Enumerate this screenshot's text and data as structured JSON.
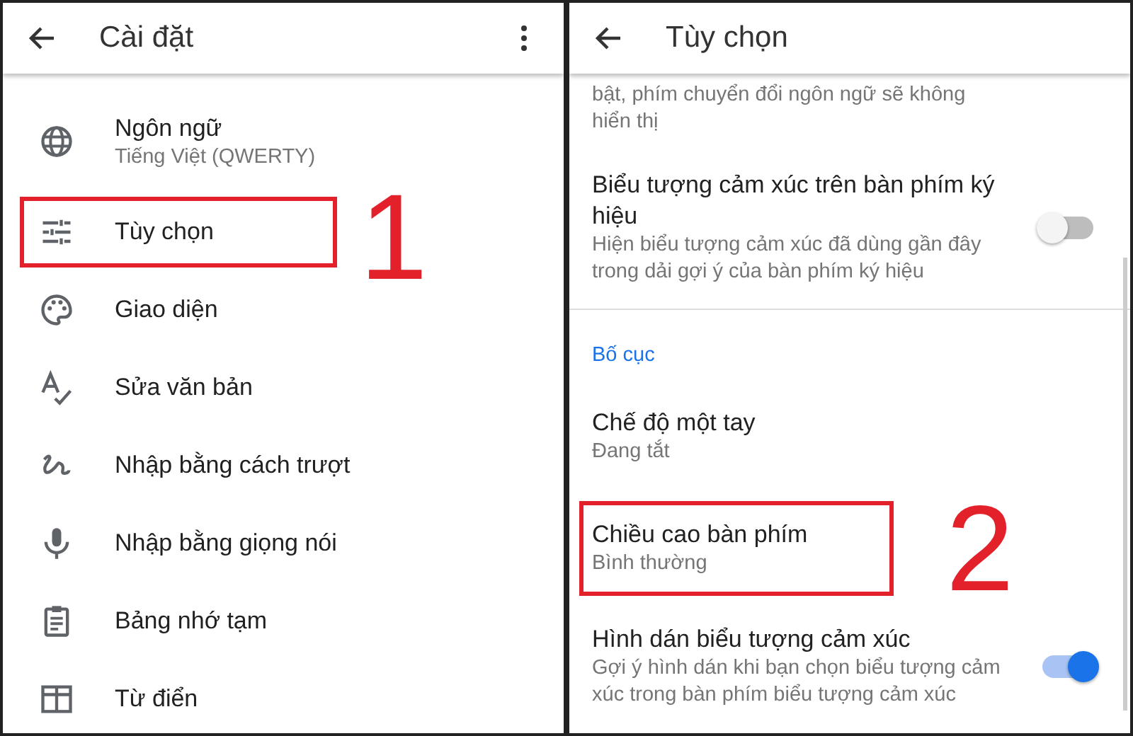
{
  "left_screen": {
    "title": "Cài đặt",
    "menu": true,
    "items": [
      {
        "label": "Ngôn ngữ",
        "subtitle": "Tiếng Việt (QWERTY)",
        "highlighted": false
      },
      {
        "label": "Tùy chọn",
        "highlighted": true,
        "step": "1"
      },
      {
        "label": "Giao diện",
        "highlighted": false
      },
      {
        "label": "Sửa văn bản",
        "highlighted": false
      },
      {
        "label": "Nhập bằng cách trượt",
        "highlighted": false
      },
      {
        "label": "Nhập bằng giọng nói",
        "highlighted": false
      },
      {
        "label": "Bảng nhớ tạm",
        "highlighted": false
      },
      {
        "label": "Từ điển",
        "highlighted": false
      }
    ]
  },
  "right_screen": {
    "title": "Tùy chọn",
    "menu": false,
    "items": [
      {
        "kind": "fragment",
        "subtitle": "bật, phím chuyển đổi ngôn ngữ sẽ không hiển thị"
      },
      {
        "kind": "switch",
        "label": "Biểu tượng cảm xúc trên bàn phím ký hiệu",
        "subtitle": "Hiện biểu tượng cảm xúc đã dùng gần đây trong dải gợi ý của bàn phím ký hiệu",
        "on": false
      },
      {
        "kind": "divider"
      },
      {
        "kind": "header",
        "label": "Bố cục"
      },
      {
        "kind": "item",
        "label": "Chế độ một tay",
        "subtitle": "Đang tắt",
        "highlighted": false
      },
      {
        "kind": "item",
        "label": "Chiều cao bàn phím",
        "subtitle": "Bình thường",
        "highlighted": true,
        "step": "2"
      },
      {
        "kind": "switch",
        "label": "Hình dán biểu tượng cảm xúc",
        "subtitle": "Gợi ý hình dán khi bạn chọn biểu tượng cảm xúc trong bàn phím biểu tượng cảm xúc",
        "on": true
      }
    ]
  }
}
